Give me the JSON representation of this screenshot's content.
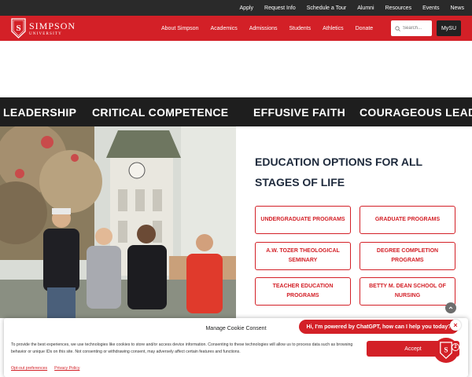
{
  "utility_nav": [
    "Apply",
    "Request Info",
    "Schedule a Tour",
    "Alumni",
    "Resources",
    "Events",
    "News"
  ],
  "logo": {
    "name": "SIMPSON",
    "subtitle": "UNIVERSITY",
    "monogram": "S"
  },
  "main_nav": [
    "About Simpson",
    "Academics",
    "Admissions",
    "Students",
    "Athletics",
    "Donate"
  ],
  "search": {
    "placeholder": "Search..."
  },
  "mysu_label": "MySU",
  "ticker": [
    "LEADERSHIP",
    "CRITICAL COMPETENCE",
    "EFFUSIVE FAITH",
    "COURAGEOUS LEADE"
  ],
  "education": {
    "title": "EDUCATION OPTIONS FOR ALL STAGES OF LIFE",
    "programs": [
      "UNDERGRADUATE PROGRAMS",
      "GRADUATE PROGRAMS",
      "A.W. TOZER THEOLOGICAL SEMINARY",
      "DEGREE COMPLETION PROGRAMS",
      "TEACHER EDUCATION PROGRAMS",
      "BETTY M. DEAN SCHOOL OF NURSING"
    ]
  },
  "chat": {
    "greeting": "Hi, I'm powered by ChatGPT, how can I help you today?",
    "close": "×",
    "badge_count": "2"
  },
  "cookie": {
    "title": "Manage Cookie Consent",
    "text": "To provide the best experiences, we use technologies like cookies to store and/or access device information. Consenting to these technologies will allow us to process data such as browsing behavior or unique IDs on this site. Not consenting or withdrawing consent, may adversely affect certain features and functions.",
    "accept": "Accept",
    "opt_out": "Opt-out preferences",
    "privacy": "Privacy Policy"
  },
  "colors": {
    "brand_red": "#d32027",
    "dark_bar": "#1e1e1e",
    "heading_navy": "#1e2a3c"
  },
  "icons": [
    "shield-logo-icon",
    "search-icon",
    "arrow-up-icon",
    "chat-logo-icon"
  ]
}
